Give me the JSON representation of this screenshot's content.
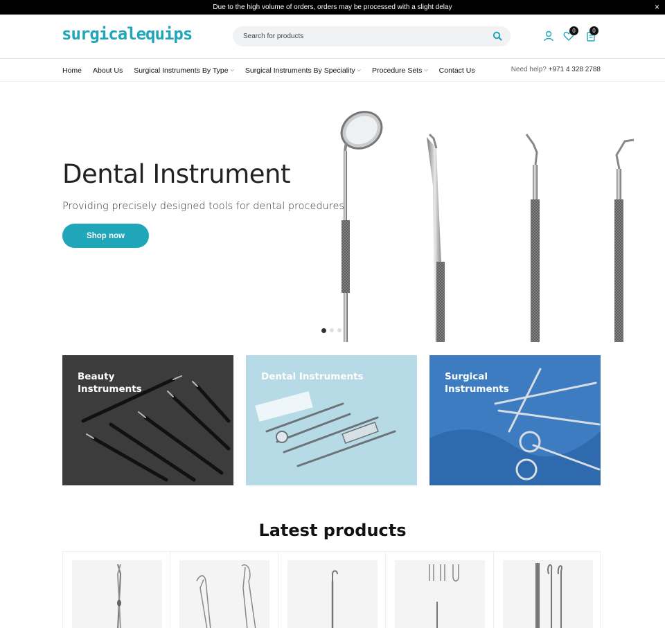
{
  "announcement": {
    "text": "Due to the high volume of orders, orders may be processed with a slight delay",
    "close": "×"
  },
  "header": {
    "logo": "surgicalequips",
    "search_placeholder": "Search for products",
    "wishlist_count": "0",
    "cart_count": "0"
  },
  "nav": {
    "items": [
      {
        "label": "Home",
        "dropdown": false
      },
      {
        "label": "About Us",
        "dropdown": false
      },
      {
        "label": "Surgical Instruments By Type",
        "dropdown": true
      },
      {
        "label": "Surgical Instruments By Speciality",
        "dropdown": true
      },
      {
        "label": "Procedure Sets",
        "dropdown": true
      },
      {
        "label": "Contact Us",
        "dropdown": false
      }
    ],
    "help_label": "Need help?",
    "help_phone": "+971 4 328 2788"
  },
  "hero": {
    "title": "Dental Instrument",
    "subtitle": "Providing precisely designed tools for dental procedures.",
    "button": "Shop now",
    "slides": 3,
    "active_slide": 1
  },
  "categories": [
    {
      "label": "Beauty\nInstruments",
      "bg": "#3a3a3a"
    },
    {
      "label": "Dental Instruments",
      "bg": "#b9dde8"
    },
    {
      "label": "Surgical\nInstruments",
      "bg": "#3f7fc4"
    }
  ],
  "latest": {
    "title": "Latest products",
    "count": 5
  },
  "colors": {
    "accent": "#1fa6b8",
    "topbar": "#000000"
  }
}
